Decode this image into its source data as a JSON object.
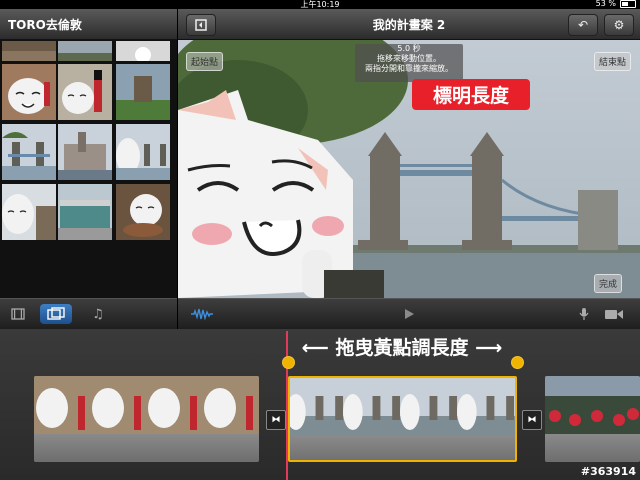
{
  "status": {
    "time": "上午10:19",
    "battery": "53 %"
  },
  "project": {
    "name": "TORO去倫敦"
  },
  "header": {
    "title": "我的計畫案 2"
  },
  "viewer": {
    "start_label": "起始點",
    "end_label": "結束點",
    "done_label": "完成",
    "tooltip_line1": "5.0 秒",
    "tooltip_line2": "拖移來移動位置。",
    "tooltip_line3": "兩指分開和靠攏來縮放。",
    "annotation": "標明長度"
  },
  "timeline": {
    "hint": "拖曳黃點調長度"
  },
  "watermark": "#363914",
  "colors": {
    "accent": "#2f6fb3",
    "handle": "#f0b400",
    "playhead": "#e03a5c",
    "annotation": "#e8202a"
  }
}
